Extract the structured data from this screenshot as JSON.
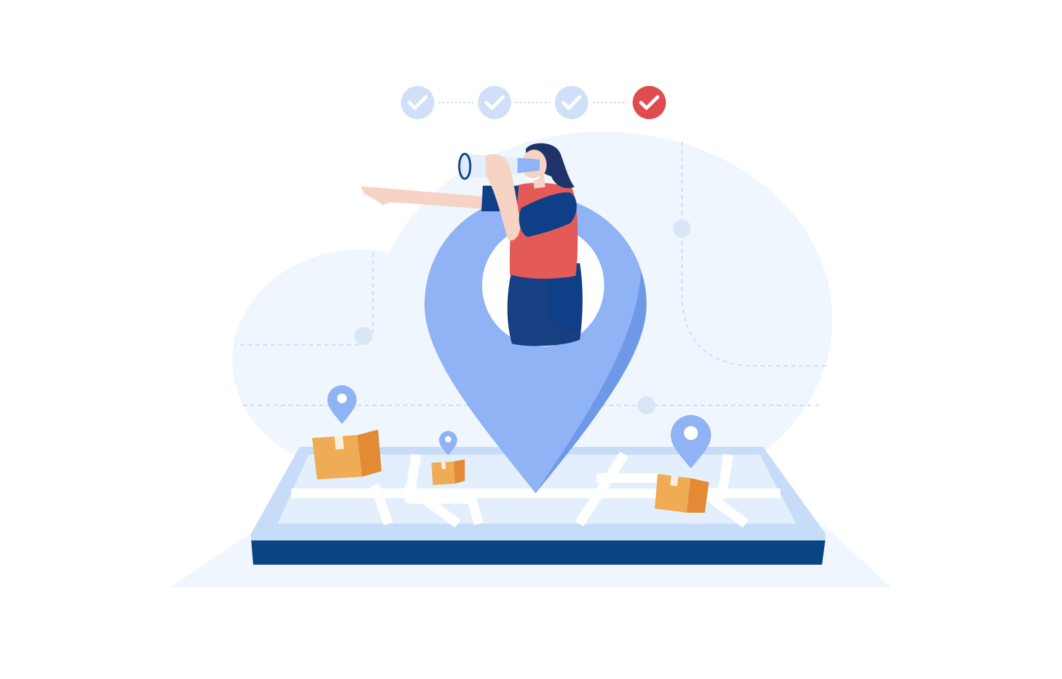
{
  "illustration": {
    "subject": "delivery-tracking",
    "colors": {
      "background": "#ffffff",
      "blob": "#f0f6fd",
      "dash_line": "#c9def3",
      "pin_blue": "#8fb3f5",
      "pin_blue_dark": "#6f98e8",
      "pin_inner": "#ffffff",
      "map_base": "#c6dcf8",
      "map_surface": "#e3effc",
      "map_roads": "#ffffff",
      "device_side": "#0a4482",
      "box_light": "#f0ac54",
      "box_dark": "#e38a35",
      "box_tape": "#ffffff",
      "skin": "#f7d3c6",
      "shirt": "#e35a58",
      "sleeve": "#0f3f86",
      "skirt": "#183f82",
      "hair": "#1e3468",
      "step_done": "#cfe0f8",
      "step_active": "#e04b4d"
    },
    "progress_steps": {
      "total": 4,
      "completed": 3,
      "active_index": 3
    },
    "icons": [
      "check-icon",
      "map-pin-icon",
      "package-box-icon",
      "binoculars-icon"
    ]
  }
}
